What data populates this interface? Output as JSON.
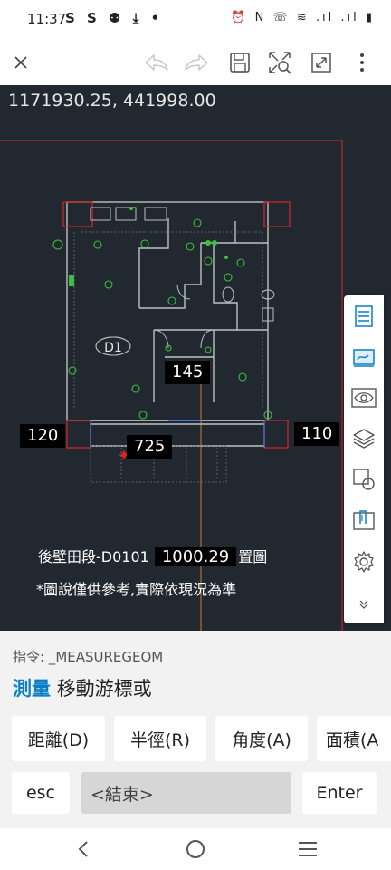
{
  "status_bar": {
    "time": "11:37",
    "left_icons": "S S ⚉ ⤓ •",
    "right_icons": "⏰ N ☏ ≋ .ıl .ıl ▮"
  },
  "canvas": {
    "coordinates": "1171930.25, 441998.00",
    "room_label": "D1",
    "dimensions": {
      "d145": "145",
      "d120": "120",
      "d110": "110",
      "d725": "725",
      "d1000": "1000.29"
    },
    "caption_line1_prefix": "後壁田段-D0101",
    "caption_line1_suffix": "置圖",
    "caption_line2": "*圖說僅供參考,實際依現況為準"
  },
  "command": {
    "history": "指令: _MEASUREGEOM",
    "prompt_keyword": "測量",
    "prompt_text": "移動游標或",
    "options": [
      "距離(D)",
      "半徑(R)",
      "角度(A)",
      "面積(A"
    ],
    "esc_label": "esc",
    "input_value": "<結束>",
    "enter_label": "Enter"
  },
  "colors": {
    "canvas_bg": "#212830",
    "accent": "#0a7fc6"
  }
}
